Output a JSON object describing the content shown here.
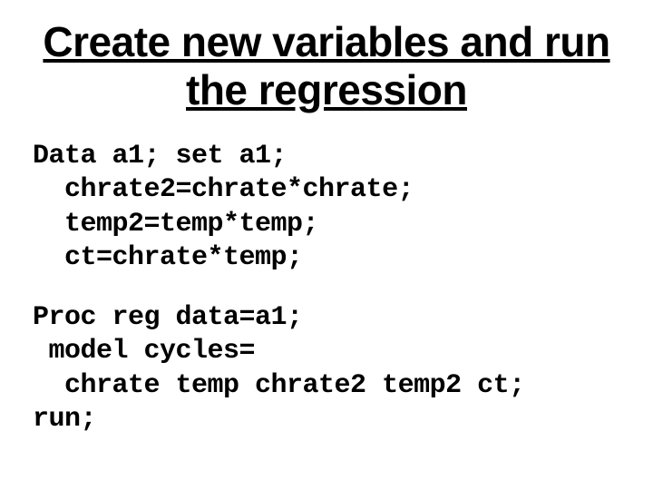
{
  "slide": {
    "title": "Create new variables and run the regression",
    "code1_l1": "Data a1; set a1;",
    "code1_l2": "  chrate2=chrate*chrate;",
    "code1_l3": "  temp2=temp*temp;",
    "code1_l4": "  ct=chrate*temp;",
    "code2_l1": "Proc reg data=a1;",
    "code2_l2": " model cycles=",
    "code2_l3": "  chrate temp chrate2 temp2 ct;",
    "code2_l4": "run;"
  }
}
